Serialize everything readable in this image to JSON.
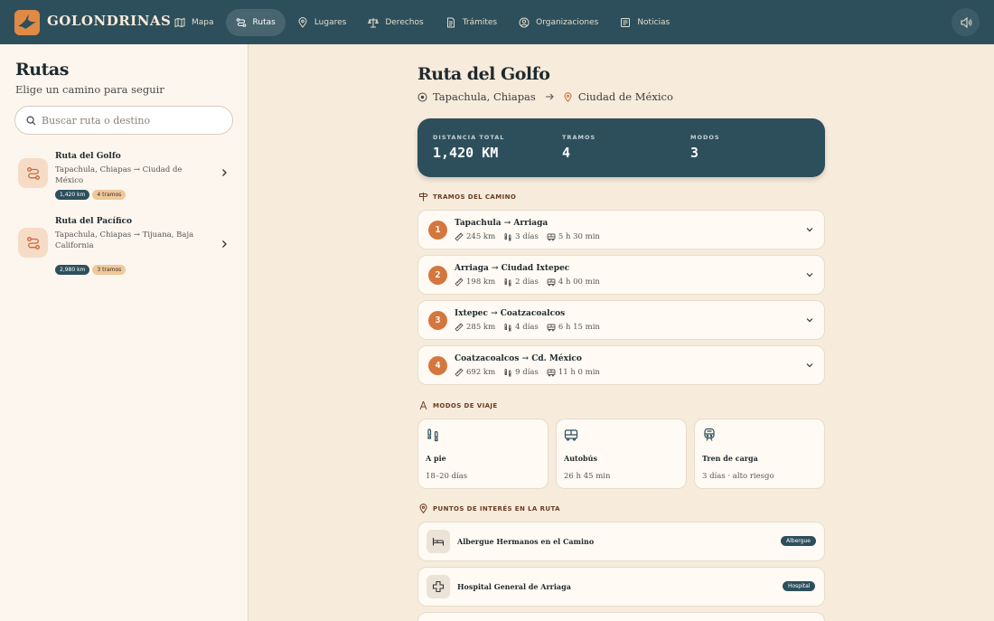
{
  "brand": {
    "name": "GOLONDRINAS",
    "logo_icon": "swallow-logo-icon",
    "accent": "#e08a45"
  },
  "nav": {
    "items": [
      {
        "label": "Mapa",
        "icon": "map-icon",
        "active": false
      },
      {
        "label": "Rutas",
        "icon": "route-icon",
        "active": true
      },
      {
        "label": "Lugares",
        "icon": "pin-icon",
        "active": false
      },
      {
        "label": "Derechos",
        "icon": "scale-icon",
        "active": false
      },
      {
        "label": "Trámites",
        "icon": "document-icon",
        "active": false
      },
      {
        "label": "Organizaciones",
        "icon": "people-icon",
        "active": false
      },
      {
        "label": "Noticias",
        "icon": "newspaper-icon",
        "active": false
      }
    ],
    "sound_icon": "speaker-icon"
  },
  "sidebar": {
    "title": "Rutas",
    "subtitle": "Elige un camino para seguir",
    "search_placeholder": "Buscar ruta o destino",
    "routes": [
      {
        "name": "Ruta del Golfo",
        "path": "Tapachula, Chiapas → Ciudad de México",
        "distance": "1,420 km",
        "segments": "4 tramos"
      },
      {
        "name": "Ruta del Pacífico",
        "path": "Tapachula, Chiapas → Tijuana, Baja California",
        "distance": "2,980 km",
        "segments": "3 tramos"
      }
    ]
  },
  "detail": {
    "title": "Ruta del Golfo",
    "origin": "Tapachula, Chiapas",
    "destination": "Ciudad de México",
    "stats": [
      {
        "label": "DISTANCIA TOTAL",
        "value": "1,420 KM"
      },
      {
        "label": "TRAMOS",
        "value": "4"
      },
      {
        "label": "MODOS",
        "value": "3"
      }
    ],
    "segments_heading": "TRAMOS DEL CAMINO",
    "segments": [
      {
        "num": "1",
        "title": "Tapachula → Arriaga",
        "distance": "245 km",
        "walk": "3 días",
        "bus": "5 h 30 min"
      },
      {
        "num": "2",
        "title": "Arriaga → Ciudad Ixtepec",
        "distance": "198 km",
        "walk": "2 días",
        "bus": "4 h 00 min"
      },
      {
        "num": "3",
        "title": "Ixtepec → Coatzacoalcos",
        "distance": "285 km",
        "walk": "4 días",
        "bus": "6 h 15 min"
      },
      {
        "num": "4",
        "title": "Coatzacoalcos → Cd. México",
        "distance": "692 km",
        "walk": "9 días",
        "bus": "11 h 0 min"
      }
    ],
    "modes_heading": "MODOS DE VIAJE",
    "modes": [
      {
        "name": "A pie",
        "value": "18–20 días",
        "icon": "footprints-icon"
      },
      {
        "name": "Autobús",
        "value": "26 h 45 min",
        "icon": "bus-icon"
      },
      {
        "name": "Tren de carga",
        "value": "3 días · alto riesgo",
        "icon": "train-icon"
      }
    ],
    "poi_heading": "PUNTOS DE INTERÉS EN LA RUTA",
    "pois": [
      {
        "name": "Albergue Hermanos en el Camino",
        "type": "Albergue",
        "icon": "bed-icon"
      },
      {
        "name": "Hospital General de Arriaga",
        "type": "Hospital",
        "icon": "medical-cross-icon"
      }
    ]
  }
}
